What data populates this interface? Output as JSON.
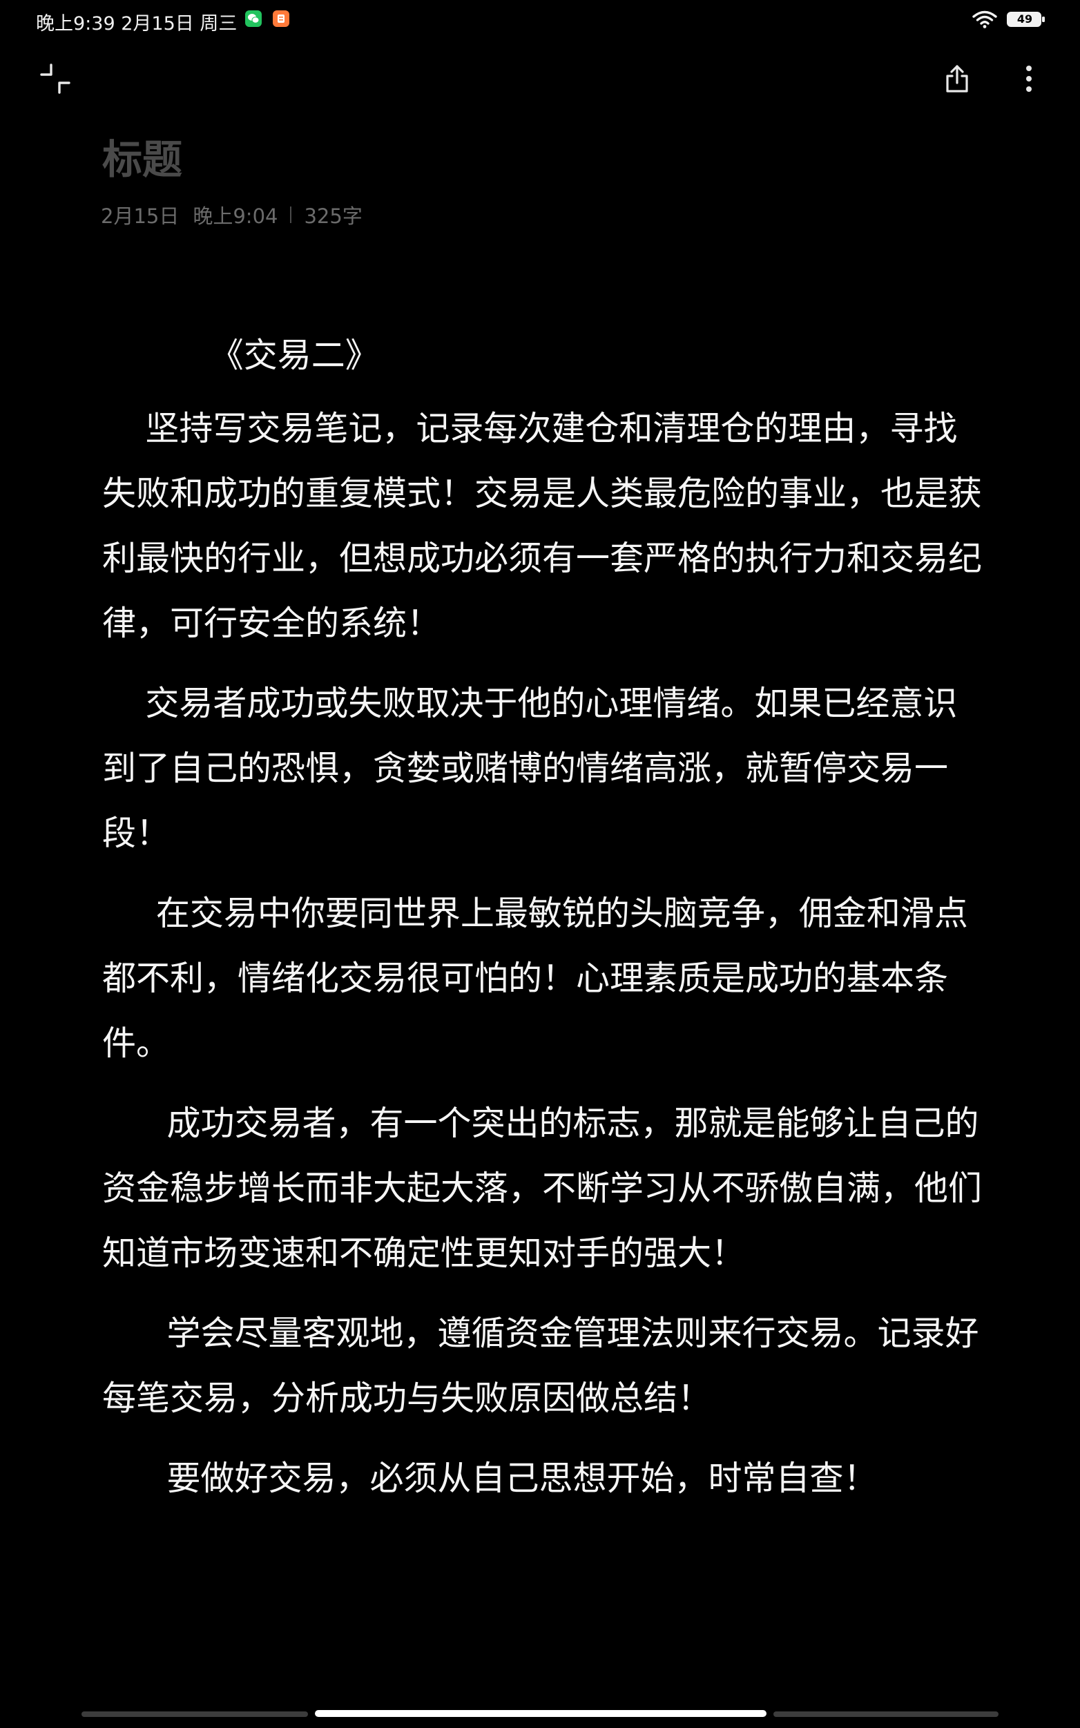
{
  "status_bar": {
    "time_text": "晚上9:39  2月15日 周三",
    "battery": "49",
    "icons": [
      "wechat-icon",
      "orange-app-icon",
      "wifi-icon",
      "battery-icon"
    ]
  },
  "toolbar": {
    "icons": [
      "collapse-icon",
      "share-icon",
      "more-vertical-icon"
    ]
  },
  "note": {
    "title": "标题",
    "date": "2月15日",
    "time": "晚上9:04",
    "word_count": "325字",
    "paragraphs": [
      "          《交易二》",
      "    坚持写交易笔记，记录每次建仓和清理仓的理由，寻找失败和成功的重复模式！交易是人类最危险的事业，也是获利最快的行业，但想成功必须有一套严格的执行力和交易纪律，可行安全的系统！",
      "    交易者成功或失败取决于他的心理情绪。如果已经意识到了自己的恐惧，贪婪或赌博的情绪高涨，就暂停交易一段！",
      "     在交易中你要同世界上最敏锐的头脑竞争，佣金和滑点都不利，情绪化交易很可怕的！心理素质是成功的基本条件。",
      "      成功交易者，有一个突出的标志，那就是能够让自己的资金稳步增长而非大起大落，不断学习从不骄傲自满，他们知道市场变速和不确定性更知对手的强大！",
      "      学会尽量客观地，遵循资金管理法则来行交易。记录好每笔交易，分析成功与失败原因做总结！",
      "      要做好交易，必须从自己思想开始，时常自查！"
    ]
  },
  "colors": {
    "background": "#000000",
    "text": "#f5f5f5",
    "title": "#4a4a4a",
    "meta": "#6b6b6b"
  }
}
